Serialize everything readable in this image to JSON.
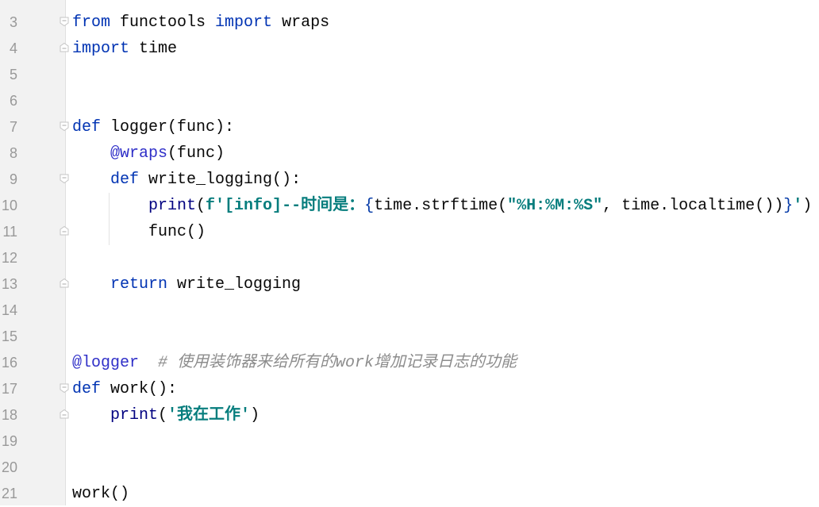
{
  "editor": {
    "lines": [
      {
        "num": "3",
        "fold": "start",
        "tokens": [
          [
            "from",
            "kw"
          ],
          [
            " functools ",
            ""
          ],
          [
            "import",
            "kw"
          ],
          [
            " wraps",
            ""
          ]
        ]
      },
      {
        "num": "4",
        "fold": "end",
        "tokens": [
          [
            "import",
            "kw"
          ],
          [
            " time",
            ""
          ]
        ]
      },
      {
        "num": "5",
        "fold": "",
        "tokens": []
      },
      {
        "num": "6",
        "fold": "",
        "tokens": []
      },
      {
        "num": "7",
        "fold": "start",
        "tokens": [
          [
            "def",
            "kw"
          ],
          [
            " logger(func):",
            ""
          ]
        ]
      },
      {
        "num": "8",
        "fold": "",
        "tokens": [
          [
            "    ",
            ""
          ],
          [
            "@wraps",
            "dec"
          ],
          [
            "(func)",
            ""
          ]
        ]
      },
      {
        "num": "9",
        "fold": "start",
        "tokens": [
          [
            "    ",
            ""
          ],
          [
            "def",
            "kw"
          ],
          [
            " write_logging():",
            ""
          ]
        ]
      },
      {
        "num": "10",
        "fold": "",
        "tokens": [
          [
            "        ",
            ""
          ],
          [
            "print",
            "bi"
          ],
          [
            "(",
            ""
          ],
          [
            "f'[info]--时间是：",
            "str"
          ],
          [
            "{",
            "brace"
          ],
          [
            "time.strftime(",
            ""
          ],
          [
            "\"%H:%M:%S\"",
            "str"
          ],
          [
            ", time.localtime())",
            ""
          ],
          [
            "}",
            "brace"
          ],
          [
            "'",
            "str"
          ],
          [
            ")",
            ""
          ]
        ]
      },
      {
        "num": "11",
        "fold": "end",
        "tokens": [
          [
            "        func()",
            ""
          ]
        ]
      },
      {
        "num": "12",
        "fold": "",
        "tokens": []
      },
      {
        "num": "13",
        "fold": "end",
        "tokens": [
          [
            "    ",
            ""
          ],
          [
            "return",
            "kw"
          ],
          [
            " write_logging",
            ""
          ]
        ]
      },
      {
        "num": "14",
        "fold": "",
        "tokens": []
      },
      {
        "num": "15",
        "fold": "",
        "tokens": []
      },
      {
        "num": "16",
        "fold": "",
        "tokens": [
          [
            "@logger",
            "dec"
          ],
          [
            "  ",
            ""
          ],
          [
            "# 使用装饰器来给所有的work增加记录日志的功能",
            "cm"
          ]
        ]
      },
      {
        "num": "17",
        "fold": "start",
        "tokens": [
          [
            "def",
            "kw"
          ],
          [
            " work():",
            ""
          ]
        ]
      },
      {
        "num": "18",
        "fold": "end",
        "tokens": [
          [
            "    ",
            ""
          ],
          [
            "print",
            "bi"
          ],
          [
            "(",
            ""
          ],
          [
            "'我在工作'",
            "str"
          ],
          [
            ")",
            ""
          ]
        ]
      },
      {
        "num": "19",
        "fold": "",
        "tokens": []
      },
      {
        "num": "20",
        "fold": "",
        "tokens": []
      },
      {
        "num": "21",
        "fold": "",
        "tokens": [
          [
            "work()",
            ""
          ]
        ]
      }
    ]
  },
  "colors": {
    "keyword": "#0033b3",
    "decorator": "#2f2fc8",
    "builtin": "#000080",
    "string": "#067d7d",
    "comment": "#8c8c8c",
    "gutter": "#f2f2f2"
  }
}
